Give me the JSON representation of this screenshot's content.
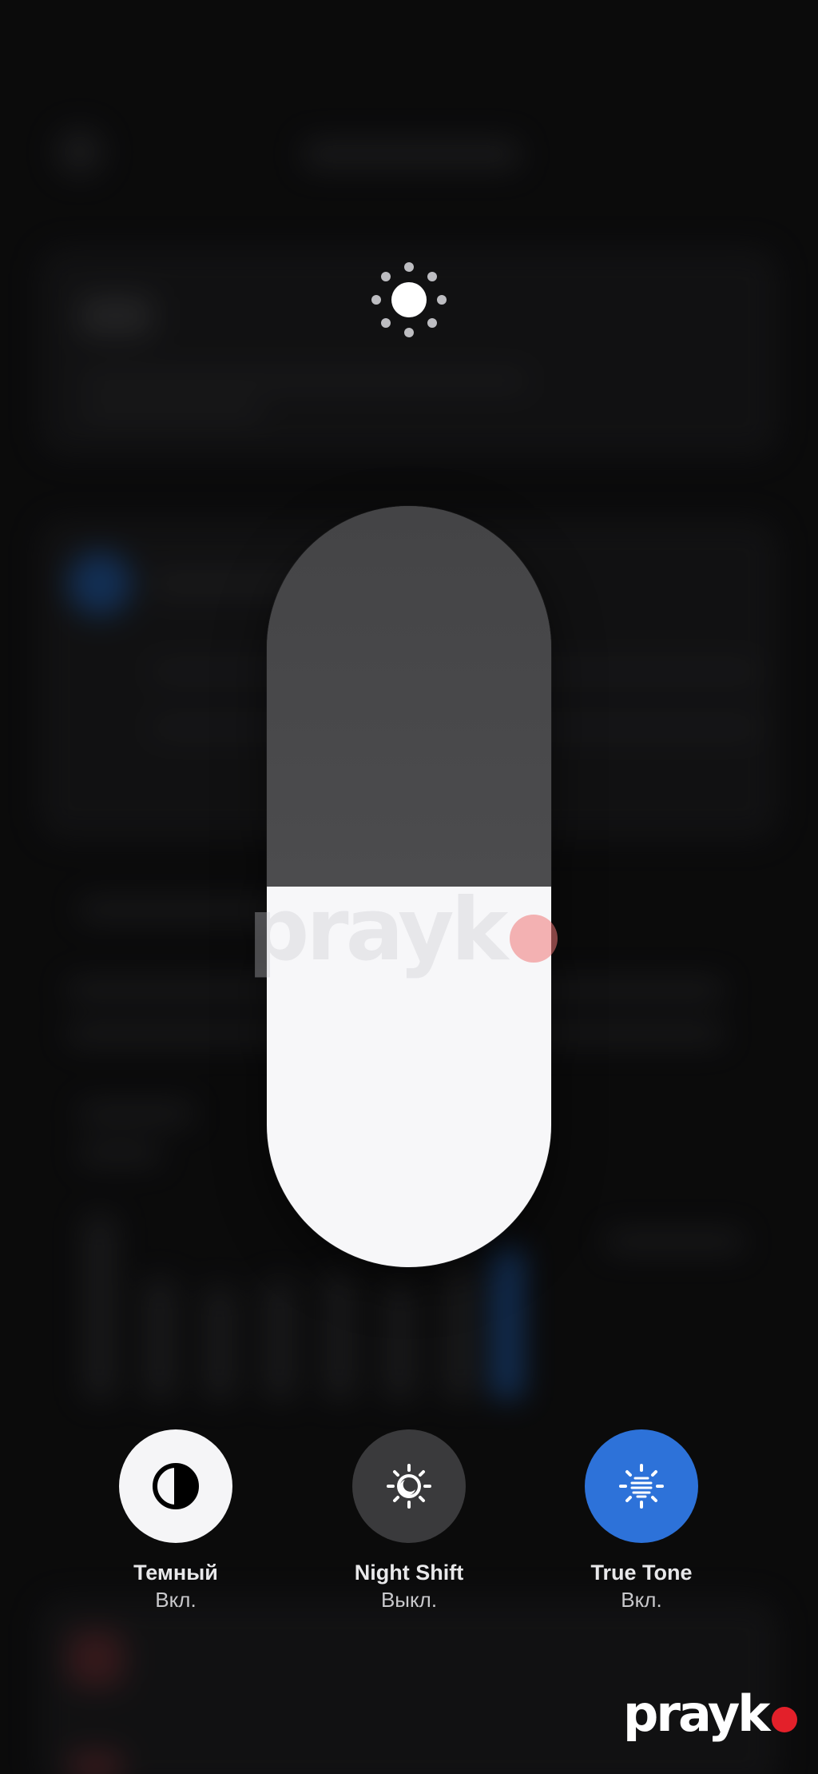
{
  "brightness": {
    "level": 0.5,
    "icon": "sun-icon"
  },
  "toggles": [
    {
      "title": "Темный",
      "status": "Вкл.",
      "icon": "dark-mode-icon",
      "active": true,
      "color": "#f5f5f7"
    },
    {
      "title": "Night Shift",
      "status": "Выкл.",
      "icon": "night-shift-icon",
      "active": false,
      "color": "#3a3a3c"
    },
    {
      "title": "True Tone",
      "status": "Вкл.",
      "icon": "true-tone-icon",
      "active": true,
      "color": "#2d72d9"
    }
  ],
  "watermark": {
    "text": "prayk",
    "dot_color": "#e3202a"
  }
}
